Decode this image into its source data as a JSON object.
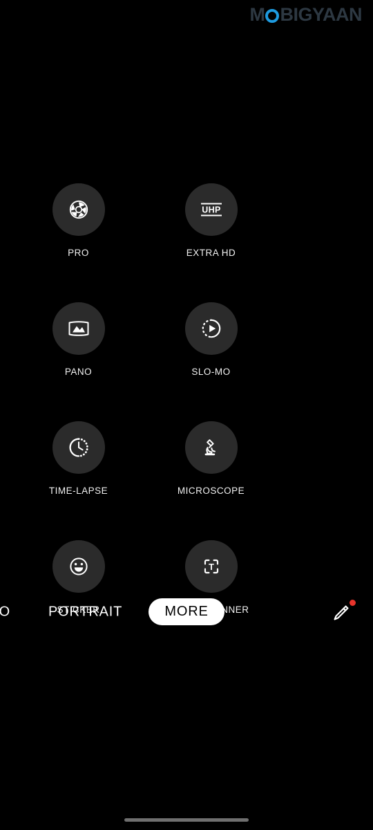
{
  "watermark": {
    "before": "M",
    "circle_letter": "O",
    "after": "BIGYAAN",
    "circle_color": "#1e9be0",
    "text_color": "#2d3842"
  },
  "modes": [
    {
      "label": "PRO",
      "icon": "aperture-icon"
    },
    {
      "label": "EXTRA HD",
      "icon": "uhp-icon"
    },
    {
      "label": "PANO",
      "icon": "panorama-icon"
    },
    {
      "label": "SLO-MO",
      "icon": "slow-motion-icon"
    },
    {
      "label": "TIME-LAPSE",
      "icon": "timelapse-clock-icon"
    },
    {
      "label": "MICROSCOPE",
      "icon": "microscope-icon"
    },
    {
      "label": "STICKER",
      "icon": "smiley-icon"
    },
    {
      "label": "TEXT SCANNER",
      "icon": "text-scanner-icon"
    }
  ],
  "mode_bar": {
    "photo_partial": "TO",
    "portrait": "PORTRAIT",
    "more": "MORE",
    "more_selected": true,
    "edit_icon": "pencil-icon",
    "edit_badge_color": "#e8342c"
  },
  "theme": {
    "background": "#000000",
    "circle_background": "#2b2b2b",
    "icon_color": "#ffffff",
    "label_color": "#f2f2f2",
    "selected_pill_background": "#ffffff",
    "selected_pill_text": "#000000",
    "gesture_bar_color": "#6f6f6f"
  }
}
